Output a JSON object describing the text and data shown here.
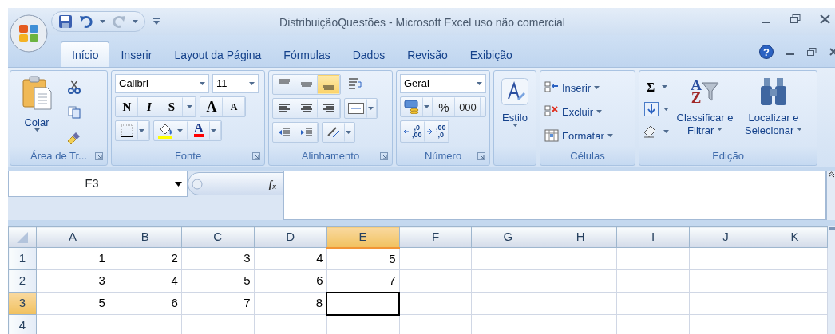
{
  "window": {
    "title": "DistribuiçãoQuestões - Microsoft Excel uso não comercial"
  },
  "tabs": [
    {
      "label": "Início",
      "selected": true
    },
    {
      "label": "Inserir",
      "selected": false
    },
    {
      "label": "Layout da Página",
      "selected": false
    },
    {
      "label": "Fórmulas",
      "selected": false
    },
    {
      "label": "Dados",
      "selected": false
    },
    {
      "label": "Revisão",
      "selected": false
    },
    {
      "label": "Exibição",
      "selected": false
    }
  ],
  "help": {
    "glyph": "?"
  },
  "ribbon": {
    "clipboard": {
      "label": "Área de Tr...",
      "paste": "Colar"
    },
    "font": {
      "label": "Fonte",
      "font_name": "Calibri",
      "font_size": "11",
      "bold": "N",
      "italic": "I",
      "underline": "S",
      "grow": "A",
      "shrink": "A",
      "font_color": "A"
    },
    "alignment": {
      "label": "Alinhamento",
      "vertical": [
        {
          "kind": "top",
          "selected": false
        },
        {
          "kind": "middle",
          "selected": false
        },
        {
          "kind": "bottom",
          "selected": true
        }
      ]
    },
    "number": {
      "label": "Número",
      "format": "Geral",
      "percent": "%",
      "thousands": "000",
      "increase_decimal": [
        ",0",
        ",00"
      ],
      "decrease_decimal": [
        ",00",
        ",0"
      ]
    },
    "styles": {
      "button": "Estilo"
    },
    "cells": {
      "label": "Células",
      "buttons": [
        {
          "kind": "insert",
          "label": "Inserir"
        },
        {
          "kind": "delete",
          "label": "Excluir"
        },
        {
          "kind": "format",
          "label": "Formatar"
        }
      ]
    },
    "editing": {
      "label": "Edição",
      "sum": "Σ",
      "sort_letters": [
        "A",
        "Z"
      ],
      "sort_filter": "Classificar e Filtrar",
      "find_select": "Localizar e Selecionar"
    }
  },
  "formula_bar": {
    "name_box": "E3",
    "fx": "f$_{x}$"
  },
  "sheet": {
    "columns": [
      {
        "label": "A",
        "selected": false
      },
      {
        "label": "B",
        "selected": false
      },
      {
        "label": "C",
        "selected": false
      },
      {
        "label": "D",
        "selected": false
      },
      {
        "label": "E",
        "selected": true
      },
      {
        "label": "F",
        "selected": false
      },
      {
        "label": "G",
        "selected": false
      },
      {
        "label": "H",
        "selected": false
      },
      {
        "label": "I",
        "selected": false
      },
      {
        "label": "J",
        "selected": false
      },
      {
        "label": "K",
        "selected": false
      }
    ],
    "rows": [
      {
        "label": "1",
        "selected": false,
        "cells": [
          {
            "value": "1",
            "selected": false
          },
          {
            "value": "2",
            "selected": false
          },
          {
            "value": "3",
            "selected": false
          },
          {
            "value": "4",
            "selected": false
          },
          {
            "value": "5",
            "selected": false
          }
        ]
      },
      {
        "label": "2",
        "selected": false,
        "cells": [
          {
            "value": "3",
            "selected": false
          },
          {
            "value": "4",
            "selected": false
          },
          {
            "value": "5",
            "selected": false
          },
          {
            "value": "6",
            "selected": false
          },
          {
            "value": "7",
            "selected": false
          }
        ]
      },
      {
        "label": "3",
        "selected": true,
        "cells": [
          {
            "value": "5",
            "selected": false
          },
          {
            "value": "6",
            "selected": false
          },
          {
            "value": "7",
            "selected": false
          },
          {
            "value": "8",
            "selected": false
          },
          {
            "selected": true
          }
        ]
      },
      {
        "label": "4",
        "selected": false,
        "cells": []
      }
    ]
  }
}
